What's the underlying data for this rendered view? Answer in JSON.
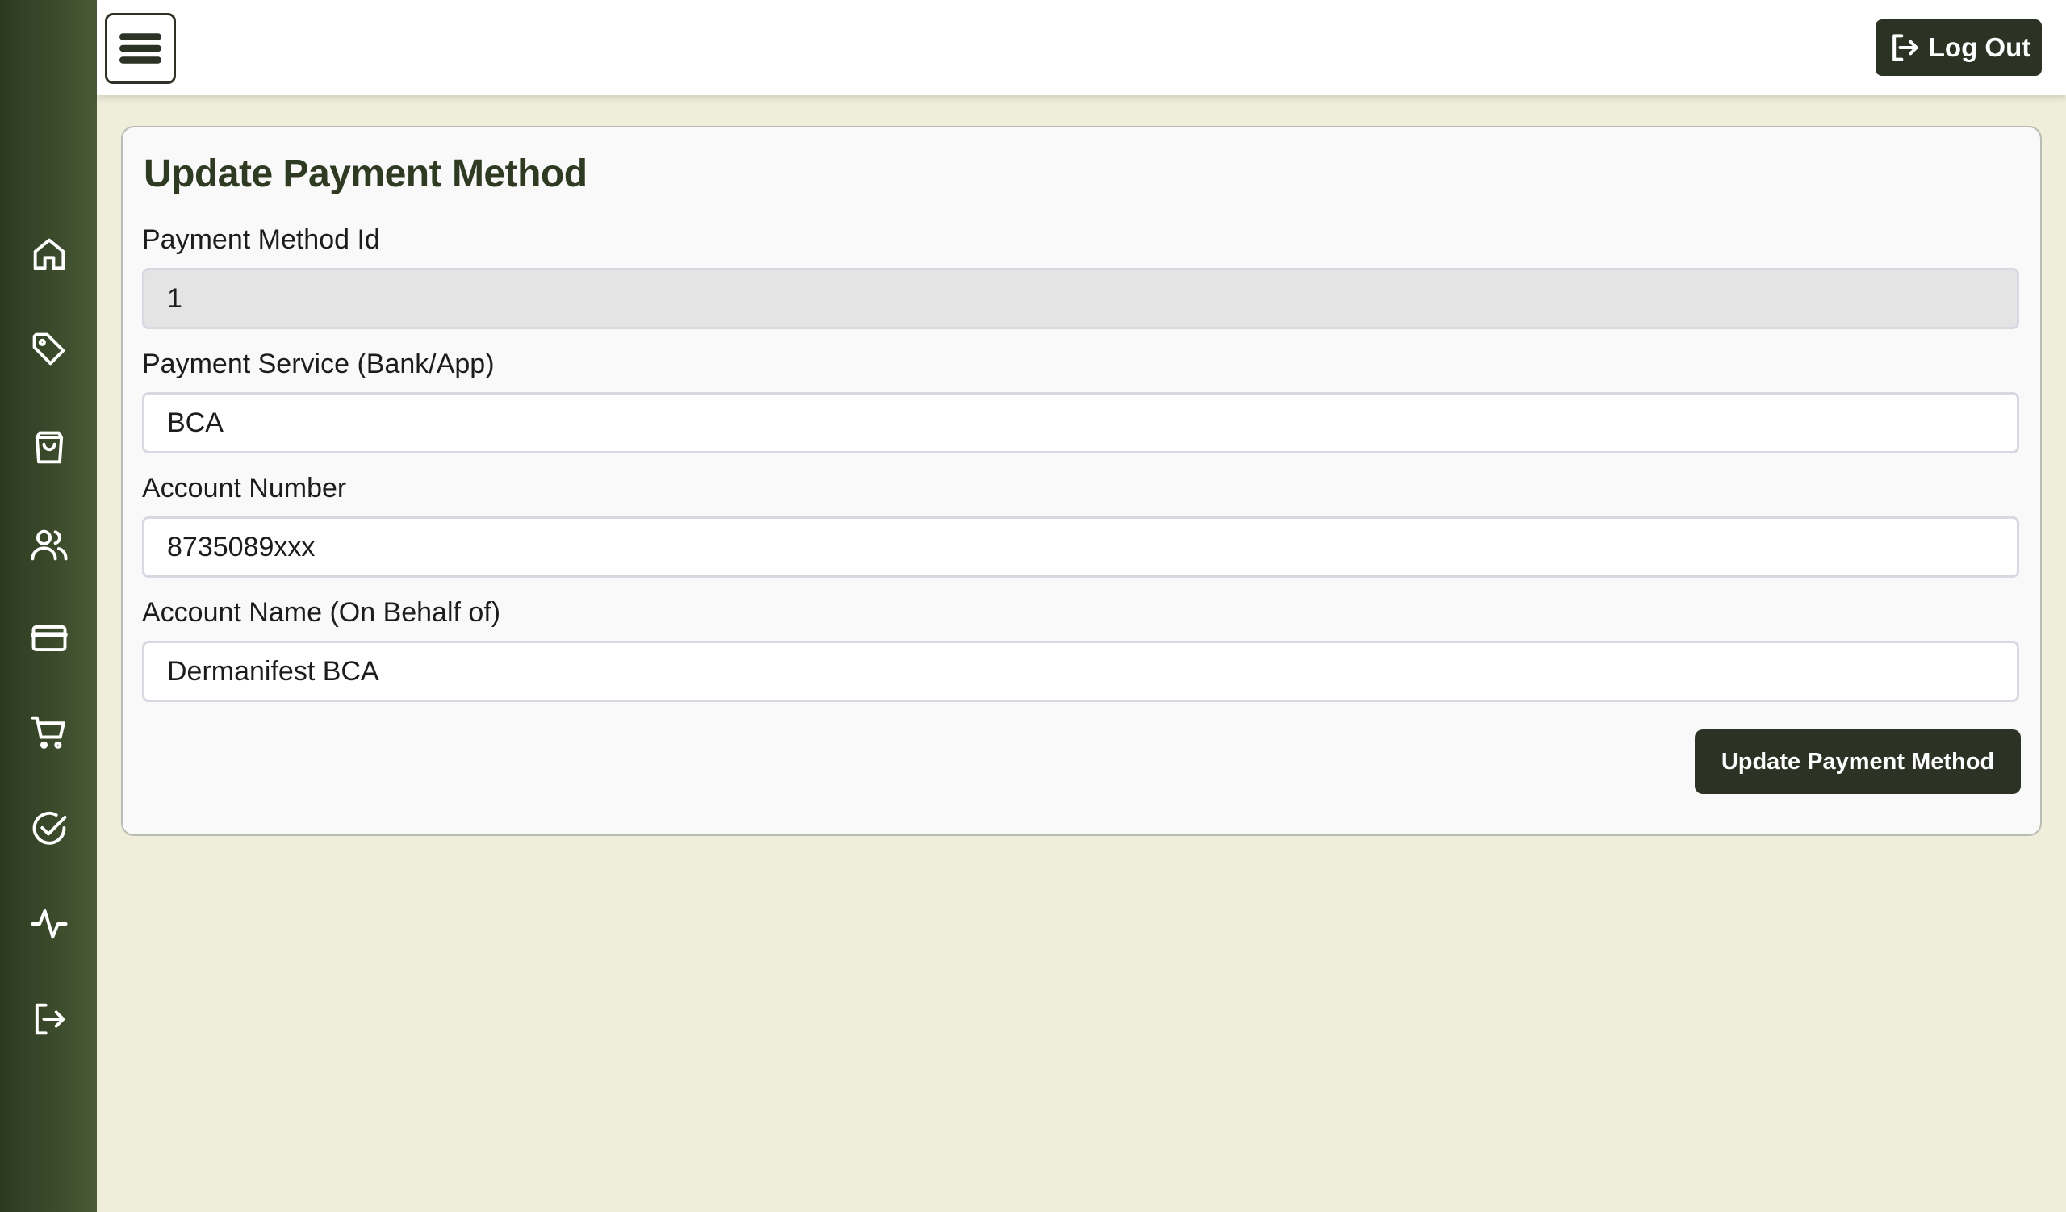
{
  "header": {
    "logout_label": "Log Out"
  },
  "sidebar": {
    "icons": [
      "home-icon",
      "tag-icon",
      "shopping-bag-icon",
      "users-icon",
      "credit-card-icon",
      "cart-icon",
      "check-circle-icon",
      "activity-icon",
      "logout-icon"
    ]
  },
  "form": {
    "title": "Update Payment Method",
    "fields": [
      {
        "label": "Payment Method Id",
        "value": "1",
        "readonly": true
      },
      {
        "label": "Payment Service (Bank/App)",
        "value": "BCA"
      },
      {
        "label": "Account Number",
        "value": "8735089xxx"
      },
      {
        "label": "Account Name (On Behalf of)",
        "value": "Dermanifest BCA"
      }
    ],
    "submit_label": "Update Payment Method"
  },
  "colors": {
    "sidebar": "#3b4a2b",
    "primary": "#2d3324",
    "background": "#efeedb"
  }
}
